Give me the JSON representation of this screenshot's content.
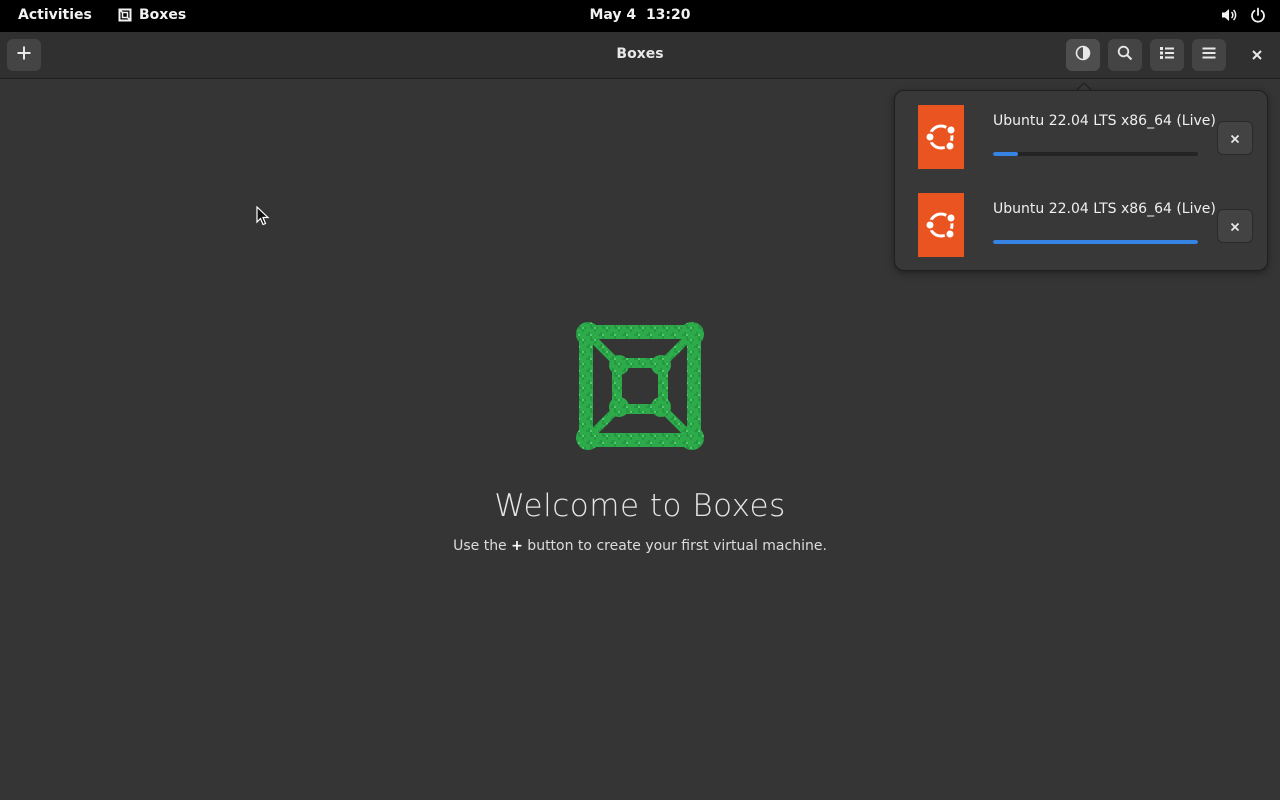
{
  "topbar": {
    "activities": "Activities",
    "app_name": "Boxes",
    "clock_date": "May 4",
    "clock_time": "13:20",
    "icons": [
      "boxes-app-icon",
      "volume-icon",
      "power-icon"
    ]
  },
  "headerbar": {
    "title": "Boxes",
    "buttons": [
      "add-icon",
      "downloads-icon",
      "search-icon",
      "list-view-icon",
      "menu-icon",
      "close-icon"
    ]
  },
  "welcome": {
    "title": "Welcome to Boxes",
    "sub_before": "Use the ",
    "sub_plus": "+",
    "sub_after": " button to create your first virtual machine."
  },
  "downloads": {
    "items": [
      {
        "name": "Ubuntu 22.04 LTS x86_64 (Live)",
        "progress": 0.12,
        "icon": "ubuntu-logo-icon"
      },
      {
        "name": "Ubuntu 22.04 LTS x86_64 (Live)",
        "progress": 1.0,
        "icon": "ubuntu-logo-icon"
      }
    ]
  },
  "colors": {
    "accent": "#3584e4",
    "ubuntu_orange": "#e95420",
    "logo_green": "#2dab4b",
    "background": "#353535"
  }
}
